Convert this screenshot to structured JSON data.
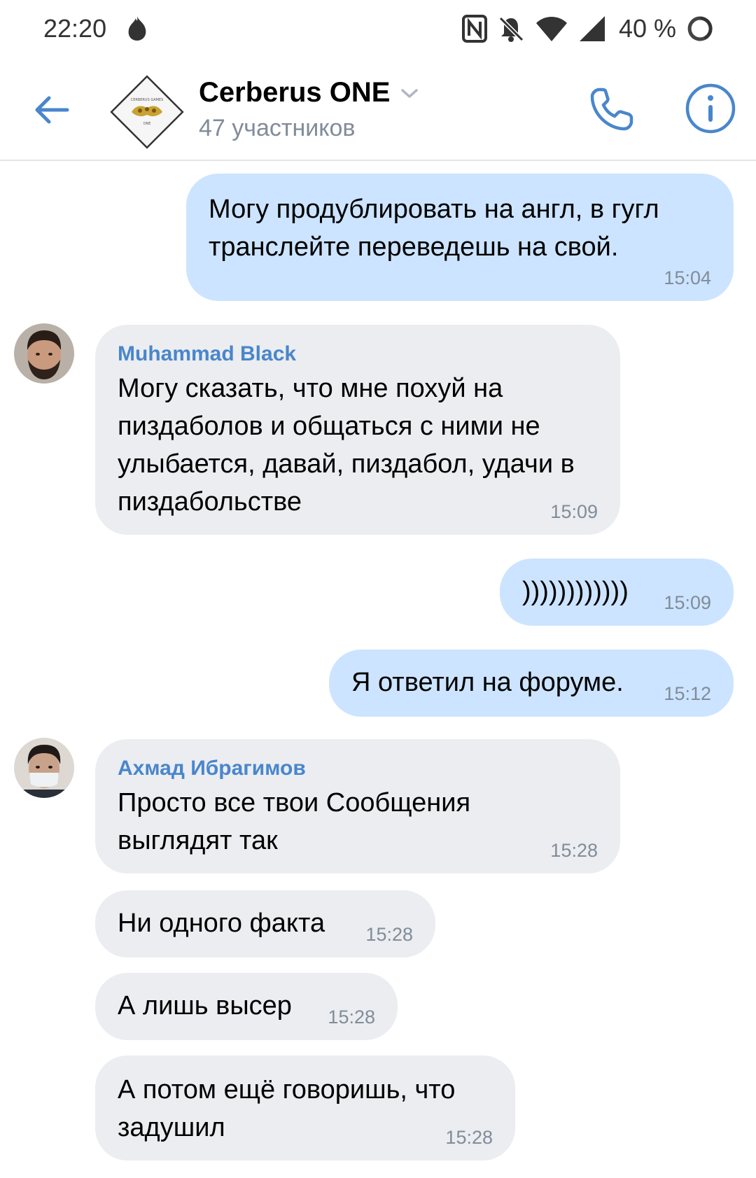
{
  "status_bar": {
    "time": "22:20",
    "battery": "40 %",
    "icons": [
      "flame-icon",
      "nfc-icon",
      "mute-bell-icon",
      "wifi-icon",
      "signal-icon",
      "battery-icon"
    ]
  },
  "header": {
    "title": "Cerberus ONE",
    "subtitle": "47 участников",
    "back_icon": "back-arrow-icon",
    "call_icon": "phone-icon",
    "info_icon": "info-icon",
    "avatar_logo_text_top": "CERBERUS GAMES",
    "avatar_logo_text_bottom": "ONE"
  },
  "colors": {
    "accent": "#4986cc",
    "outgoing_bubble": "#cce4ff",
    "incoming_bubble": "#ebedf0",
    "secondary_text": "#818c99"
  },
  "messages": [
    {
      "direction": "out",
      "text": "Могу продублировать на англ, в гугл транслейте переведешь на свой.",
      "time": "15:04"
    },
    {
      "direction": "in",
      "author": "Muhammad Black",
      "text": "Могу сказать, что мне похуй на пиздаболов и общаться с ними не улыбается, давай, пиздабол, удачи в пиздабольстве",
      "time": "15:09"
    },
    {
      "direction": "out",
      "text": "))))))))))))",
      "time": "15:09"
    },
    {
      "direction": "out",
      "text": "Я ответил на форуме.",
      "time": "15:12"
    },
    {
      "direction": "in",
      "author": "Ахмад Ибрагимов",
      "text": "Просто все твои Сообщения выглядят так",
      "time": "15:28"
    },
    {
      "direction": "in",
      "text": "Ни одного факта",
      "time": "15:28"
    },
    {
      "direction": "in",
      "text": "А лишь высер",
      "time": "15:28"
    },
    {
      "direction": "in",
      "text": "А потом ещё говоришь, что задушил",
      "time": "15:28"
    }
  ]
}
